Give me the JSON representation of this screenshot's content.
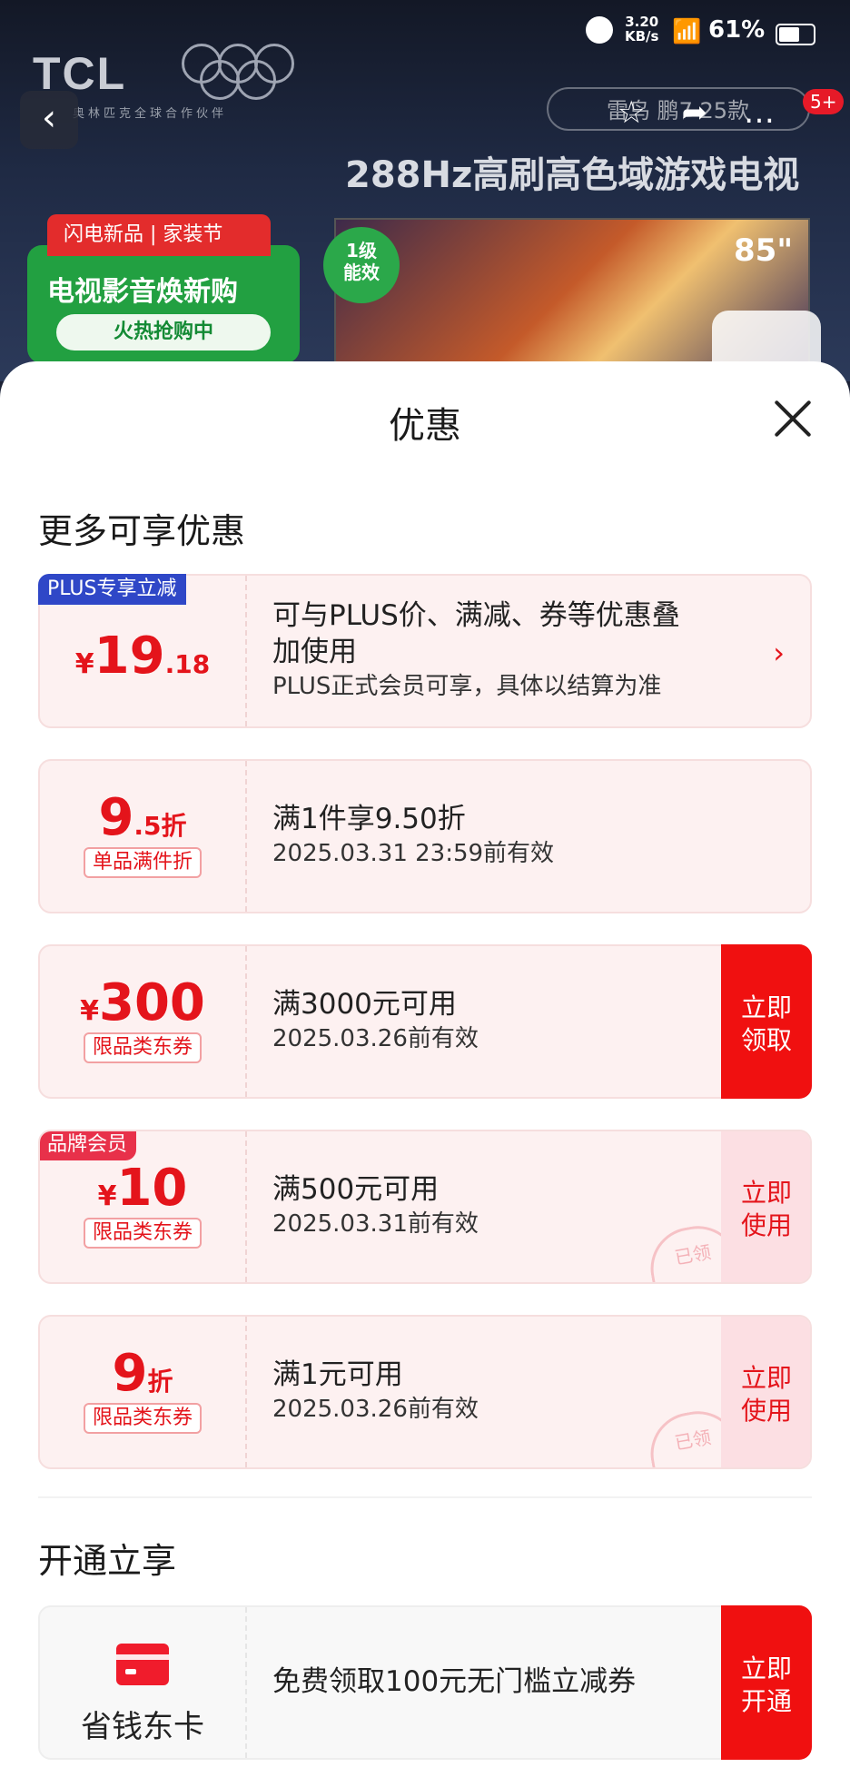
{
  "status_bar": {
    "speed_value": "3.20",
    "speed_unit": "KB/s",
    "battery": "61%"
  },
  "banner": {
    "brand": "TCL",
    "brand_sub": "奥林匹克全球合作伙伴",
    "search_placeholder": "雷鸟 鹏7 25款",
    "badge": "5+",
    "headline": "288Hz高刷高色域游戏电视",
    "promo_tag": "闪电新品 | 家装节",
    "promo_title": "电视影音焕新购",
    "promo_button": "火热抢购中",
    "energy_label": "1级\n能效",
    "screen_size": "85\""
  },
  "sheet": {
    "title": "优惠",
    "section_more": "更多可享优惠",
    "section_open": "开通立享"
  },
  "coupons": [
    {
      "corner_tag": "PLUS专享立减",
      "symbol": "¥",
      "big": "19",
      "small": ".18",
      "line1": "可与PLUS价、满减、券等优惠叠",
      "line1b": "加使用",
      "line2": "PLUS正式会员可享，具体以结算为准"
    },
    {
      "big": "9",
      "small": ".5折",
      "tag": "单品满件折",
      "line1": "满1件享9.50折",
      "line2": "2025.03.31 23:59前有效"
    },
    {
      "symbol": "¥",
      "big": "300",
      "tag": "限品类东券",
      "line1": "满3000元可用",
      "line2": "2025.03.26前有效",
      "action": "立即\n领取"
    },
    {
      "corner_tag": "品牌会员",
      "symbol": "¥",
      "big": "10",
      "tag": "限品类东券",
      "line1": "满500元可用",
      "line2": "2025.03.31前有效",
      "action": "立即\n使用",
      "stamp": "已领"
    },
    {
      "big": "9",
      "small": "折",
      "tag": "限品类东券",
      "line1": "满1元可用",
      "line2": "2025.03.26前有效",
      "action": "立即\n使用",
      "stamp": "已领"
    }
  ],
  "membership": {
    "name": "省钱东卡",
    "desc": "免费领取100元无门槛立减券",
    "action": "立即\n开通"
  },
  "colors": {
    "accent_red": "#e4141b",
    "button_red": "#f01010",
    "plus_blue": "#2f47c7",
    "brand_member_red": "#e8314a",
    "card_bg": "#fdf1f1"
  }
}
